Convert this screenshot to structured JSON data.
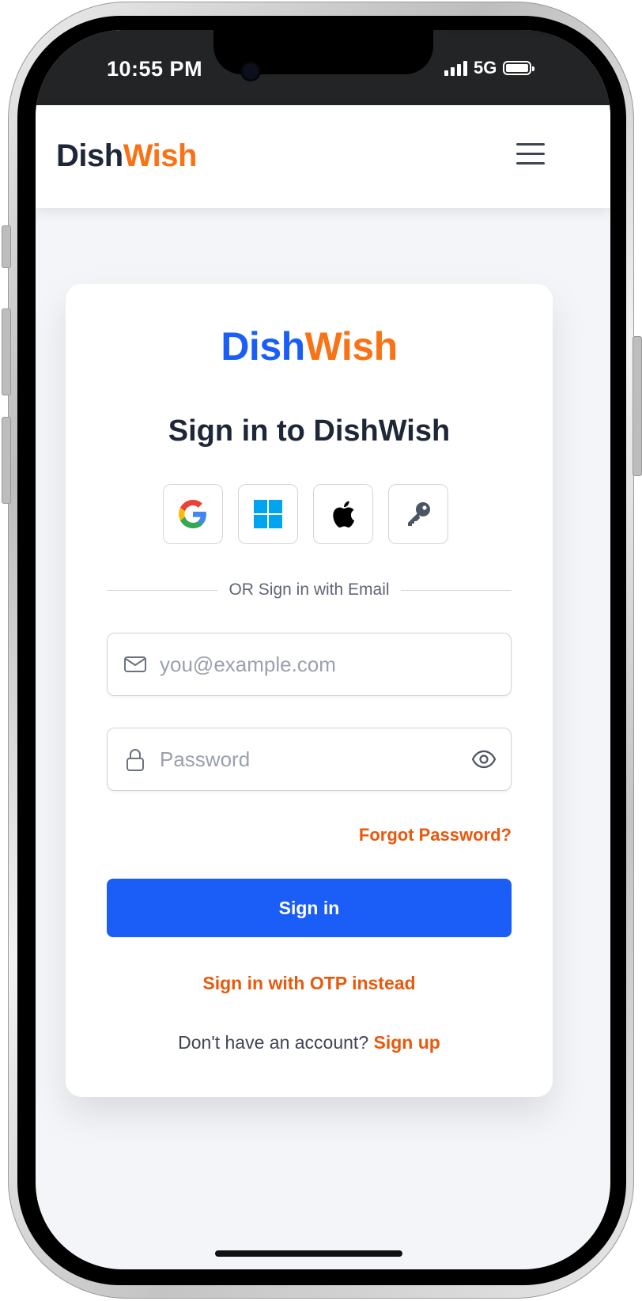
{
  "status_bar": {
    "time": "10:55 PM",
    "network": "5G",
    "battery_level": 1.0
  },
  "navbar": {
    "brand_part1": "Dish",
    "brand_part2": "Wish",
    "brand_color1": "#1e2738",
    "brand_color2": "#f97316",
    "menu_icon": "hamburger-menu-icon"
  },
  "card": {
    "logo_part1": "Dish",
    "logo_part2": "Wish",
    "logo_color1": "#1a5ef7",
    "logo_color2": "#f97316",
    "title": "Sign in to DishWish",
    "social_buttons": [
      {
        "icon": "google-icon"
      },
      {
        "icon": "microsoft-icon"
      },
      {
        "icon": "apple-icon"
      },
      {
        "icon": "key-icon"
      }
    ],
    "divider_text": "OR Sign in with Email",
    "email": {
      "icon": "mail-icon",
      "placeholder": "you@example.com",
      "value": ""
    },
    "password": {
      "icon": "lock-icon",
      "placeholder": "Password",
      "value": "",
      "toggle_icon": "eye-icon"
    },
    "forgot_password": "Forgot Password?",
    "signin_button": "Sign in",
    "otp_link": "Sign in with OTP instead",
    "signup_prompt": "Don't have an account?",
    "signup_link": "Sign up"
  },
  "colors": {
    "primary": "#1a5ef7",
    "accent": "#ea580c",
    "background": "#f3f5f8"
  }
}
